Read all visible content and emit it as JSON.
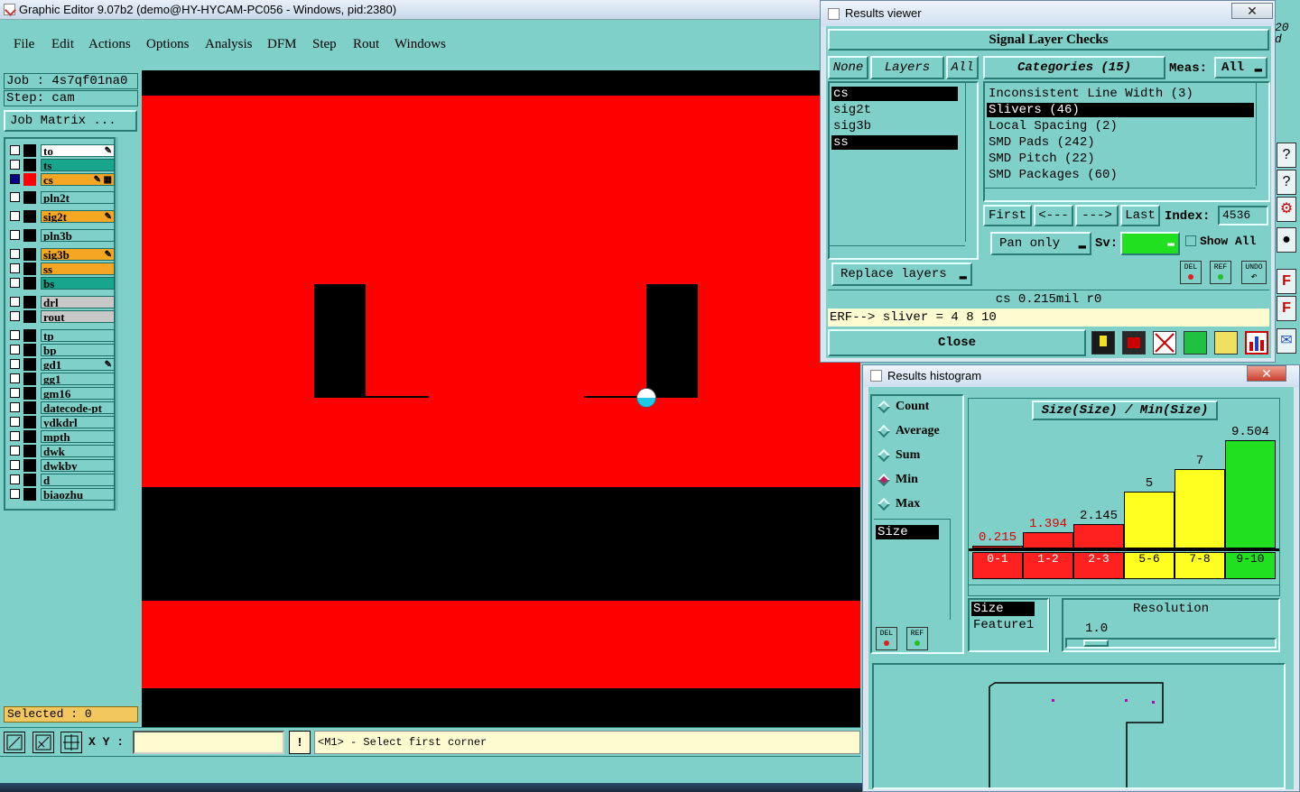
{
  "app": {
    "title": "Graphic Editor 9.07b2 (demo@HY-HYCAM-PC056 - Windows, pid:2380)"
  },
  "menu": [
    "File",
    "Edit",
    "Actions",
    "Options",
    "Analysis",
    "DFM",
    "Step",
    "Rout",
    "Windows"
  ],
  "left": {
    "job": "Job : 4s7qf01na0",
    "step": "Step: cam",
    "job_matrix": "Job Matrix ...",
    "selected": "Selected : 0",
    "layers": [
      {
        "name": "to",
        "color": "#ffffff",
        "checked": false,
        "swatch": "#000000",
        "mark": "✎"
      },
      {
        "name": "ts",
        "color": "#17a58e",
        "checked": false,
        "swatch": "#000000",
        "mark": ""
      },
      {
        "name": "cs",
        "color": "#f5a623",
        "checked": true,
        "swatch": "#ff0000",
        "mark": "✎ ▦"
      },
      {
        "name": "pln2t",
        "color": "#7fd0c8",
        "checked": false,
        "swatch": "#000000",
        "mark": ""
      },
      {
        "name": "sig2t",
        "color": "#f5a623",
        "checked": false,
        "swatch": "#000000",
        "mark": "✎"
      },
      {
        "name": "pln3b",
        "color": "#7fd0c8",
        "checked": false,
        "swatch": "#000000",
        "mark": ""
      },
      {
        "name": "sig3b",
        "color": "#f5a623",
        "checked": false,
        "swatch": "#000000",
        "mark": "✎"
      },
      {
        "name": "ss",
        "color": "#f5a623",
        "checked": false,
        "swatch": "#000000",
        "mark": ""
      },
      {
        "name": "bs",
        "color": "#17a58e",
        "checked": false,
        "swatch": "#000000",
        "mark": ""
      },
      {
        "name": "drl",
        "color": "#c8c8c8",
        "checked": false,
        "swatch": "#000000",
        "mark": ""
      },
      {
        "name": "rout",
        "color": "#c8c8c8",
        "checked": false,
        "swatch": "#000000",
        "mark": ""
      },
      {
        "name": "tp",
        "color": "#7fd0c8",
        "checked": false,
        "swatch": "#000000",
        "mark": ""
      },
      {
        "name": "bp",
        "color": "#7fd0c8",
        "checked": false,
        "swatch": "#000000",
        "mark": ""
      },
      {
        "name": "gd1",
        "color": "#7fd0c8",
        "checked": false,
        "swatch": "#000000",
        "mark": "✎"
      },
      {
        "name": "gg1",
        "color": "#7fd0c8",
        "checked": false,
        "swatch": "#000000",
        "mark": ""
      },
      {
        "name": "gm16",
        "color": "#7fd0c8",
        "checked": false,
        "swatch": "#000000",
        "mark": ""
      },
      {
        "name": "datecode-pt",
        "color": "#7fd0c8",
        "checked": false,
        "swatch": "#000000",
        "mark": ""
      },
      {
        "name": "ydkdrl",
        "color": "#7fd0c8",
        "checked": false,
        "swatch": "#000000",
        "mark": ""
      },
      {
        "name": "mpth",
        "color": "#7fd0c8",
        "checked": false,
        "swatch": "#000000",
        "mark": ""
      },
      {
        "name": "dwk",
        "color": "#7fd0c8",
        "checked": false,
        "swatch": "#000000",
        "mark": ""
      },
      {
        "name": "dwkby",
        "color": "#7fd0c8",
        "checked": false,
        "swatch": "#000000",
        "mark": ""
      },
      {
        "name": "d",
        "color": "#7fd0c8",
        "checked": false,
        "swatch": "#000000",
        "mark": ""
      },
      {
        "name": "biaozhu",
        "color": "#7fd0c8",
        "checked": false,
        "swatch": "#000000",
        "mark": ""
      }
    ]
  },
  "bottom": {
    "xy_label": "X Y :",
    "xy_value": "",
    "warn": "!",
    "prompt": "<M1> - Select first corner"
  },
  "results_viewer": {
    "title": "Results viewer",
    "close_x": "✕",
    "header": "Signal Layer Checks",
    "none": "None",
    "layers_label": "Layers",
    "all": "All",
    "categories_label": "Categories (15)",
    "meas_label": "Meas:",
    "meas_value": "All",
    "layers": [
      "cs",
      "sig2t",
      "sig3b",
      "ss"
    ],
    "selected_layers": [
      "cs",
      "ss"
    ],
    "categories": [
      "Inconsistent Line Width (3)",
      "Slivers (46)",
      "Local Spacing (2)",
      "SMD Pads (242)",
      "SMD Pitch (22)",
      "SMD Packages (60)"
    ],
    "selected_category": "Slivers (46)",
    "first": "First",
    "prev": "<---",
    "next": "--->",
    "last": "Last",
    "index_label": "Index:",
    "index_value": "4536",
    "pan_only": "Pan only",
    "sv_label": "Sv:",
    "show_all": "Show All",
    "replace_layers": "Replace layers",
    "del": "DEL",
    "ref": "REF",
    "undo": "UNDO",
    "status": "cs 0.215mil  r0",
    "erf": "ERF--> sliver = 4 8 10",
    "close": "Close"
  },
  "histogram": {
    "title": "Results histogram",
    "close_x": "✕",
    "modes": [
      "Count",
      "Average",
      "Sum",
      "Min",
      "Max"
    ],
    "selected_mode": "Min",
    "attr_list": [
      "Size"
    ],
    "plot_title": "Size(Size) / Min(Size)",
    "size_list": [
      "Size",
      "Feature1"
    ],
    "resolution_label": "Resolution",
    "resolution_value": "1.0",
    "del": "DEL",
    "ref": "REF"
  },
  "chart_data": {
    "type": "bar",
    "title": "Size(Size) / Min(Size)",
    "categories": [
      "0-1",
      "1-2",
      "2-3",
      "5-6",
      "7-8",
      "9-10"
    ],
    "values": [
      0.215,
      1.394,
      2.145,
      5,
      7,
      9.504
    ],
    "value_labels": [
      "0.215",
      "1.394",
      "2.145",
      "5",
      "7",
      "9.504"
    ],
    "bar_colors": [
      "#ff2020",
      "#ff2020",
      "#ff2020",
      "#ffff20",
      "#ffff20",
      "#20e020"
    ],
    "ylim": [
      0,
      10
    ]
  },
  "right_strip": {
    "top_text": "20\nd",
    "buttons": [
      "?",
      "?",
      "⚙",
      "●",
      "F",
      "F",
      "✉"
    ]
  },
  "colors": {
    "bg": "#7fd0c8",
    "pcb_red": "#ff0000",
    "pcb_black": "#000000"
  }
}
